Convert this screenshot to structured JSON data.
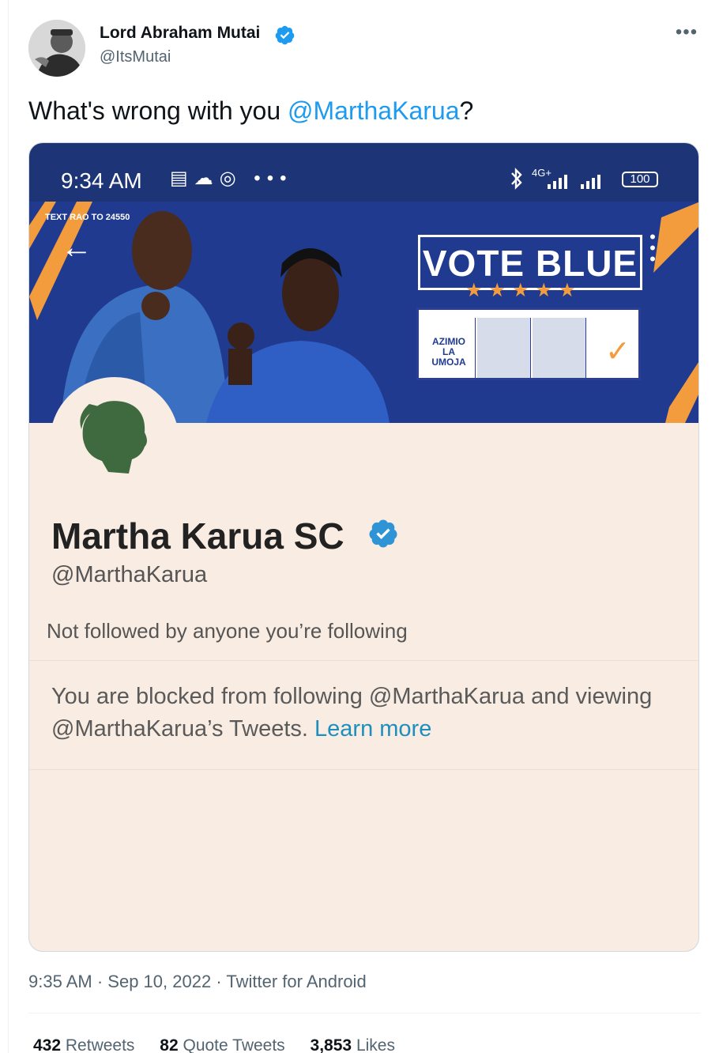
{
  "author": {
    "name": "Lord Abraham Mutai",
    "handle": "@ItsMutai"
  },
  "tweet": {
    "text_before": "What's wrong with you ",
    "mention": "@MarthaKarua",
    "text_after": "?"
  },
  "screenshot": {
    "status_bar": {
      "time": "9:34 AM",
      "network": "4G+",
      "battery": "100"
    },
    "banner": {
      "sms_text": "TEXT RAO TO 24550",
      "headline": "VOTE BLUE",
      "stars": "★★★★★",
      "party_name": "AZIMIO LA UMOJA"
    },
    "profile": {
      "name": "Martha Karua SC",
      "handle": "@MarthaKarua",
      "followers_note": "Not followed by anyone you’re following",
      "blocked_message": "You are blocked from following @MarthaKarua and viewing @MarthaKarua’s Tweets.",
      "learn_more": "Learn more"
    }
  },
  "meta": {
    "time": "9:35 AM",
    "date": "Sep 10, 2022",
    "source": "Twitter for Android",
    "separator": "·"
  },
  "stats": {
    "retweets_count": "432",
    "retweets_label": "Retweets",
    "quotes_count": "82",
    "quotes_label": "Quote Tweets",
    "likes_count": "3,853",
    "likes_label": "Likes"
  },
  "colors": {
    "accent": "#1d9bf0",
    "banner_blue": "#1f3a8f",
    "card_bg": "#f9ece2",
    "orange": "#f39c3e"
  },
  "icons": [
    "verified-badge-icon",
    "more-options-icon",
    "back-arrow-icon",
    "bluetooth-icon",
    "signal-icon",
    "battery-icon"
  ]
}
